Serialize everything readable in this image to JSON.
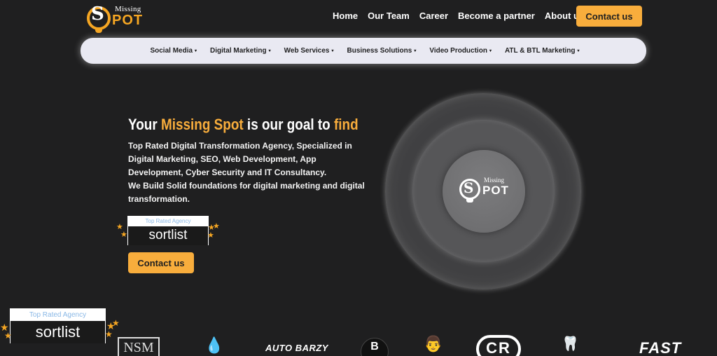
{
  "logo": {
    "missing": "Missing",
    "pot": "POT",
    "s": "S"
  },
  "nav": {
    "links": [
      "Home",
      "Our Team",
      "Career",
      "Become a partner",
      "About us"
    ],
    "contact": "Contact us"
  },
  "subnav": [
    {
      "label": "Social Media",
      "caret": "▾"
    },
    {
      "label": "Digital Marketing",
      "caret": "▾"
    },
    {
      "label": "Web Services",
      "caret": "▾"
    },
    {
      "label": "Business Solutions",
      "caret": "▾"
    },
    {
      "label": "Video Production",
      "caret": "▾"
    },
    {
      "label": "ATL & BTL Marketing",
      "caret": "▾"
    }
  ],
  "hero": {
    "headline_1": "Your ",
    "headline_accent_1": "Missing Spot",
    "headline_2": " is our goal to ",
    "headline_accent_2": "find",
    "description_1": "Top Rated Digital Transformation Agency, Specialized in Digital Marketing, SEO, Web Development, App Development, Cyber Security and IT Consultancy.",
    "description_2": "We Build Solid foundations for digital marketing and digital transformation.",
    "contact": "Contact us"
  },
  "badge": {
    "top": "Top Rated Agency",
    "bottom": "sortlist"
  },
  "circle_logo": {
    "missing": "Missing",
    "pot": "POT",
    "s": "S"
  },
  "clients": {
    "barzy": "AUTO BARZY",
    "bona": "B",
    "cr": "CR",
    "fast": "FAST"
  },
  "colors": {
    "accent": "#f8ad3c",
    "background": "#1f1f20",
    "subnav_bg": "#e9e9f2"
  },
  "icons": {
    "star": "star-icon",
    "drop": "drop-icon",
    "chef": "chef-hat-icon",
    "tooth": "tooth-icon",
    "caret": "caret-down-icon"
  }
}
